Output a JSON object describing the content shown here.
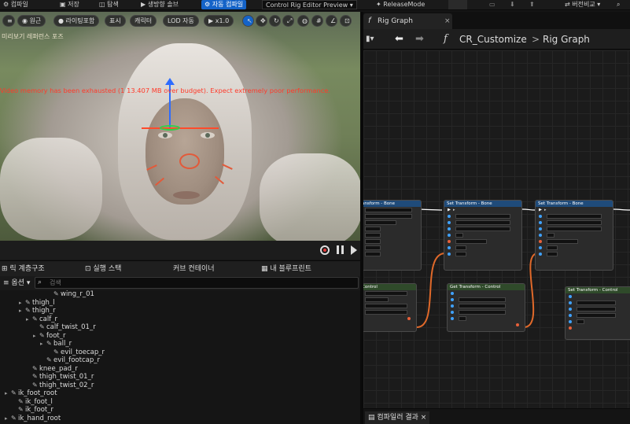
{
  "toolbar": {
    "compile": "컴파일",
    "save": "저장",
    "browse": "탐색",
    "build_solver": "생방향 솔브",
    "auto_compile": "자동 컴파일",
    "preview_mode": "Control Rig Editor Preview",
    "release_mode": "ReleaseMode",
    "diff": "버전비교"
  },
  "viewport": {
    "perspective": "원근",
    "lighting": "라이팅포함",
    "show": "표시",
    "character": "캐릭터",
    "lod": "LOD 자동",
    "play_speed": "x1.0",
    "preview_label": "미리보기 레퍼런스 포즈",
    "warning": "Video memory has been exhausted (1 13.407 MB over budget). Expect extremely poor performance."
  },
  "bottom_tabs": {
    "hierarchy": "릭 계층구조",
    "exec_stack": "실행 스택",
    "curve_container": "커브 컨테이너",
    "my_blueprint": "내 블루프린트"
  },
  "tree": {
    "options_label": "옵션",
    "search_placeholder": "검색",
    "rows": [
      {
        "label": "wing_r_01",
        "depth": 6,
        "arrow": false
      },
      {
        "label": "thigh_l",
        "depth": 2,
        "arrow": true
      },
      {
        "label": "thigh_r",
        "depth": 2,
        "arrow": true
      },
      {
        "label": "calf_r",
        "depth": 3,
        "arrow": true
      },
      {
        "label": "calf_twist_01_r",
        "depth": 4,
        "arrow": false
      },
      {
        "label": "foot_r",
        "depth": 4,
        "arrow": true
      },
      {
        "label": "ball_r",
        "depth": 5,
        "arrow": true
      },
      {
        "label": "evil_toecap_r",
        "depth": 6,
        "arrow": false
      },
      {
        "label": "evil_footcap_r",
        "depth": 5,
        "arrow": false
      },
      {
        "label": "knee_pad_r",
        "depth": 3,
        "arrow": false
      },
      {
        "label": "thigh_twist_01_r",
        "depth": 3,
        "arrow": false
      },
      {
        "label": "thigh_twist_02_r",
        "depth": 3,
        "arrow": false
      },
      {
        "label": "ik_foot_root",
        "depth": 0,
        "arrow": true
      },
      {
        "label": "ik_foot_l",
        "depth": 1,
        "arrow": false
      },
      {
        "label": "ik_foot_r",
        "depth": 1,
        "arrow": false
      },
      {
        "label": "ik_hand_root",
        "depth": 0,
        "arrow": true
      }
    ]
  },
  "rig_graph": {
    "tab_label": "Rig Graph",
    "crumb_root": "CR_Customize",
    "crumb_sep": ">",
    "crumb_leaf": "Rig Graph",
    "compiler_results_tab": "컴파일러 결과"
  },
  "colors": {
    "accent_blue": "#1463c8",
    "warning_red": "#ff3a2a",
    "wire_orange": "#e0692a",
    "node_header_blue": "#1f4b7a",
    "node_header_green": "#2f4a2a"
  }
}
